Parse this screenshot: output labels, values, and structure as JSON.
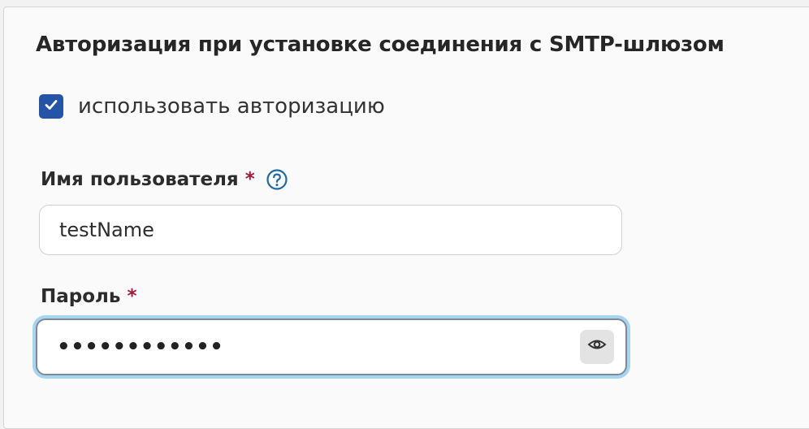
{
  "section": {
    "title": "Авторизация при установке соединения с SMTP-шлюзом"
  },
  "auth_checkbox": {
    "checked": true,
    "label": "использовать авторизацию"
  },
  "username": {
    "label": "Имя пользователя",
    "required_mark": "*",
    "value": "testName"
  },
  "password": {
    "label": "Пароль",
    "required_mark": "*",
    "masked_value": "••••••••••••"
  },
  "colors": {
    "accent": "#2554a6",
    "required": "#a11a3c",
    "focus_ring": "#a6d5ef",
    "help_icon": "#1d6aa5"
  },
  "icons": {
    "checkbox": "check-icon",
    "help": "question-circle-icon",
    "reveal": "eye-icon"
  }
}
